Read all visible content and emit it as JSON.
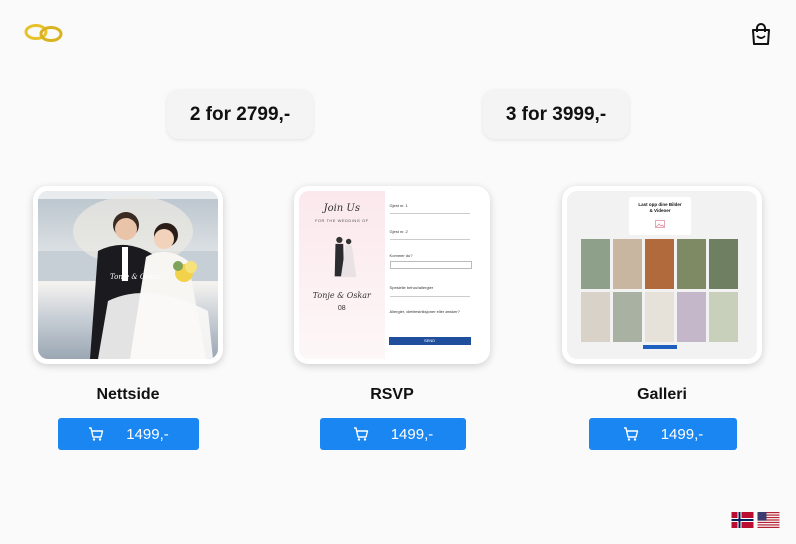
{
  "header": {
    "logo_icon": "wedding-rings-icon",
    "cart_icon": "shopping-bag-icon"
  },
  "deals": [
    {
      "label": "2 for 2799,-"
    },
    {
      "label": "3 for 3999,-"
    }
  ],
  "products": [
    {
      "title": "Nettside",
      "price": "1499,-",
      "cart_icon": "cart-icon"
    },
    {
      "title": "RSVP",
      "price": "1499,-",
      "cart_icon": "cart-icon"
    },
    {
      "title": "Galleri",
      "price": "1499,-",
      "cart_icon": "cart-icon"
    }
  ],
  "previews": {
    "rsvp": {
      "script_title": "Join Us",
      "subtitle": "FOR THE WEDDING OF",
      "names": "Tonje & Oskar",
      "date_day": "08",
      "field1": "Gjest nr. 1",
      "field2": "Gjest nr. 2",
      "field3": "Kommer du?",
      "field4": "Spesielle behov/allergier",
      "field5": "Allergier, diettrestriksjoner eller ønsker?",
      "submit": "SEND"
    },
    "gallery": {
      "heading": "Last opp dine Bilder & Videoer"
    }
  },
  "flags": [
    {
      "name": "norway-flag-icon"
    },
    {
      "name": "us-flag-icon"
    }
  ],
  "colors": {
    "accent": "#1a86f2",
    "gold": "#e8c22a"
  }
}
